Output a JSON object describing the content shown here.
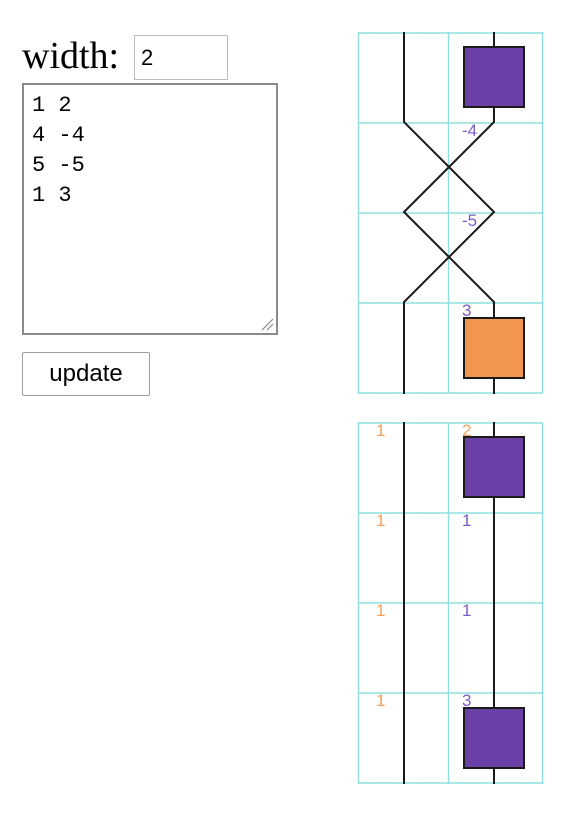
{
  "form": {
    "width_label": "width:",
    "width_value": "2",
    "textarea_value": "1 2\n4 -4\n5 -5\n1 3",
    "update_label": "update"
  },
  "colors": {
    "grid": "#8ee0e0",
    "wire": "#1a1a1a",
    "box_purple": "#6a40a6",
    "box_orange": "#f2954e",
    "label_purple": "#7b5cc4",
    "label_orange": "#f2a15e"
  },
  "diagrams": [
    {
      "name": "top",
      "rows": 4,
      "wires": [
        {
          "segments": [
            [
              "0",
              "0"
            ],
            [
              "0",
              "1"
            ],
            [
              "1",
              "2"
            ],
            [
              "0",
              "3"
            ],
            [
              "0",
              "4"
            ]
          ]
        },
        {
          "segments": [
            [
              "1",
              "0"
            ],
            [
              "1",
              "1"
            ],
            [
              "0",
              "2"
            ],
            [
              "1",
              "3"
            ],
            [
              "1",
              "4"
            ]
          ]
        }
      ],
      "crossings": [
        1,
        2
      ],
      "labels": [
        {
          "text": "-4",
          "row": 1,
          "lane": 1,
          "color": "purple"
        },
        {
          "text": "-5",
          "row": 2,
          "lane": 1,
          "color": "purple"
        },
        {
          "text": "3",
          "row": 3,
          "lane": 1,
          "color": "purple"
        }
      ],
      "boxes": [
        {
          "row": 0,
          "lane": 1,
          "color": "purple"
        },
        {
          "row": 3,
          "lane": 1,
          "color": "orange"
        }
      ]
    },
    {
      "name": "bottom",
      "rows": 4,
      "wires": [],
      "crossings": [],
      "labels": [
        {
          "text": "1",
          "row": 0,
          "lane": 0,
          "color": "orange"
        },
        {
          "text": "2",
          "row": 0,
          "lane": 1,
          "color": "orange"
        },
        {
          "text": "1",
          "row": 1,
          "lane": 0,
          "color": "orange"
        },
        {
          "text": "1",
          "row": 1,
          "lane": 1,
          "color": "purple"
        },
        {
          "text": "1",
          "row": 2,
          "lane": 0,
          "color": "orange"
        },
        {
          "text": "1",
          "row": 2,
          "lane": 1,
          "color": "purple"
        },
        {
          "text": "1",
          "row": 3,
          "lane": 0,
          "color": "orange"
        },
        {
          "text": "3",
          "row": 3,
          "lane": 1,
          "color": "purple"
        }
      ],
      "boxes": [
        {
          "row": 0,
          "lane": 1,
          "color": "purple"
        },
        {
          "row": 3,
          "lane": 1,
          "color": "purple"
        }
      ]
    }
  ]
}
